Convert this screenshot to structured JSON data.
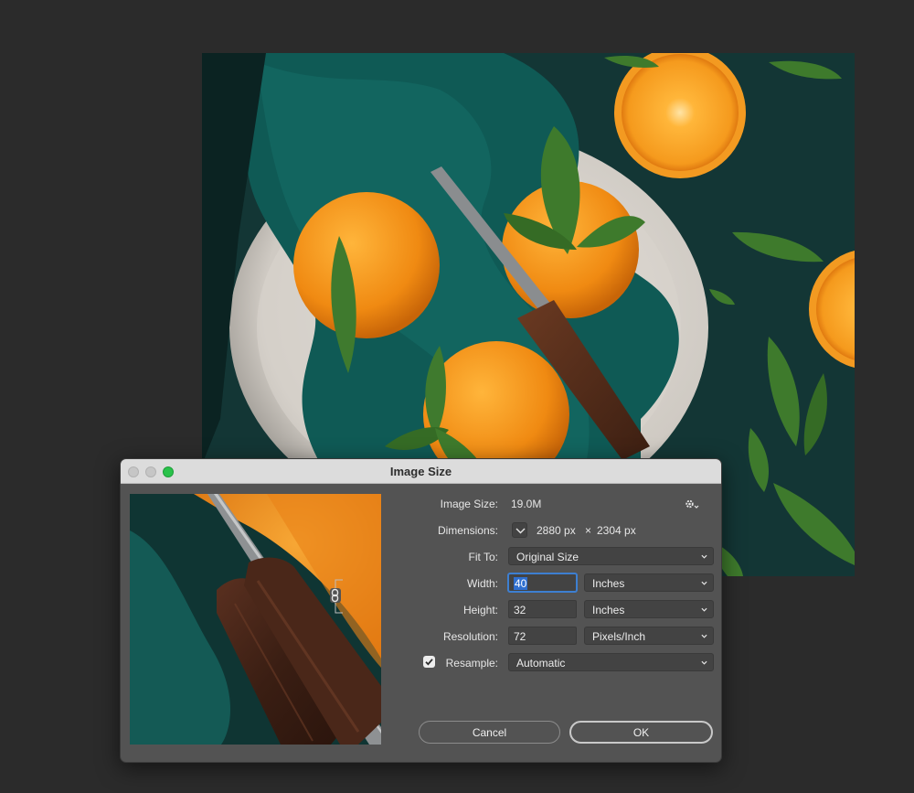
{
  "dialog": {
    "title": "Image Size"
  },
  "fields": {
    "image_size_label": "Image Size:",
    "image_size_value": "19.0M",
    "dimensions_label": "Dimensions:",
    "dimensions_width": "2880 px",
    "dimensions_times": "×",
    "dimensions_height": "2304 px",
    "fit_to_label": "Fit To:",
    "fit_to_value": "Original Size",
    "width_label": "Width:",
    "width_value": "40",
    "width_unit": "Inches",
    "height_label": "Height:",
    "height_value": "32",
    "height_unit": "Inches",
    "resolution_label": "Resolution:",
    "resolution_value": "72",
    "resolution_unit": "Pixels/Inch",
    "resample_label": "Resample:",
    "resample_checked": true,
    "resample_value": "Automatic"
  },
  "buttons": {
    "cancel": "Cancel",
    "ok": "OK"
  },
  "icons": {
    "settings": "gear-icon",
    "link": "link-icon",
    "dimensions_toggle": "chevron-down-icon",
    "select_chevron": "chevron-down-icon"
  },
  "colors": {
    "titlebar": "#dcdcdc",
    "dialog_bg": "#535353",
    "field_bg": "#434343",
    "focus": "#3d7fd1",
    "zoom_button": "#2ac24a"
  }
}
